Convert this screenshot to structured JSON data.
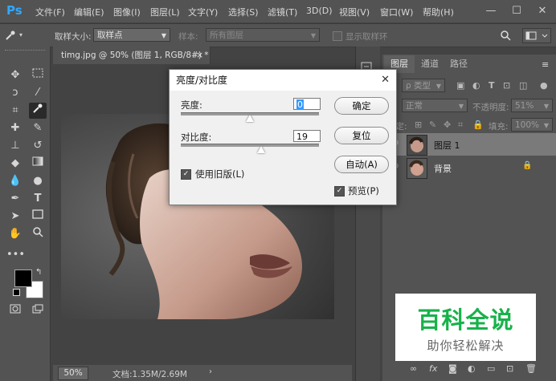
{
  "app": {
    "logo": "Ps"
  },
  "menu": [
    "文件(F)",
    "编辑(E)",
    "图像(I)",
    "图层(L)",
    "文字(Y)",
    "选择(S)",
    "滤镜(T)",
    "3D(D)",
    "视图(V)",
    "窗口(W)",
    "帮助(H)"
  ],
  "window_controls": {
    "minimize": "—",
    "maximize": "☐",
    "close": "✕"
  },
  "options": {
    "sample_size_label": "取样大小:",
    "sample_size_value": "取样点",
    "sample_label": "样本:",
    "sample_value": "所有图层",
    "show_ring_label": "显示取样环"
  },
  "document": {
    "tab_title": "timg.jpg @ 50% (图层 1, RGB/8#) *",
    "tab_close": "×",
    "zoom": "50%",
    "doc_info": "文档:1.35M/2.69M"
  },
  "panel": {
    "tabs": [
      "图层",
      "通道",
      "路径"
    ],
    "kind_label": "ρ 类型",
    "blend_mode": "正常",
    "opacity_label": "不透明度:",
    "opacity_value": "51%",
    "lock_label": "锁定:",
    "fill_label": "填充:",
    "fill_value": "100%",
    "layers": [
      {
        "name": "图层 1",
        "selected": true
      },
      {
        "name": "背景",
        "selected": false
      }
    ],
    "footer_icons": [
      "link-icon",
      "fx-icon",
      "mask-icon",
      "adjustment-icon",
      "group-icon",
      "new-layer-icon",
      "trash-icon"
    ]
  },
  "dialog": {
    "title": "亮度/对比度",
    "close": "✕",
    "brightness_label": "亮度:",
    "brightness_value": "0",
    "brightness_fraction": 0.5,
    "contrast_label": "对比度:",
    "contrast_value": "19",
    "contrast_fraction": 0.58,
    "use_legacy_label": "使用旧版(L)",
    "use_legacy_checked": true,
    "ok_label": "确定",
    "reset_label": "复位",
    "auto_label": "自动(A)",
    "preview_label": "预览(P)",
    "preview_checked": true
  },
  "watermark": {
    "title": "百科全说",
    "subtitle": "助你轻松解决"
  },
  "colors": {
    "accent": "#31a8ff",
    "watermark_green": "#17b24a"
  }
}
